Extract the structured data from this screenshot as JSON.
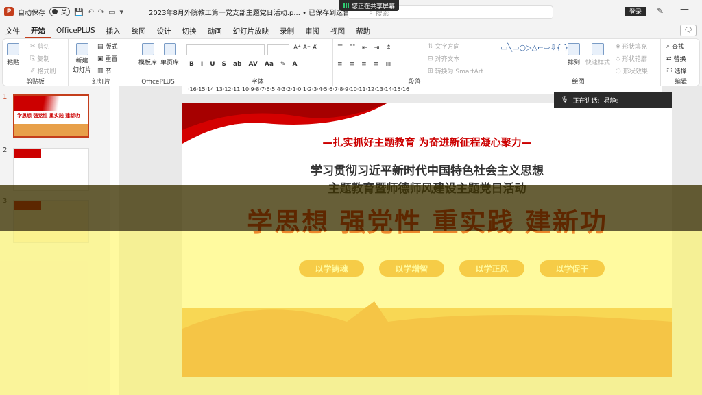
{
  "titlebar": {
    "autosave_label": "自动保存",
    "autosave_state": "关",
    "doc_title": "2023年8月外院教工第一党支部主题党日活动.p...",
    "save_status": "• 已保存到这台电脑",
    "share_banner": "您正在共享屏幕",
    "search_placeholder": "搜索",
    "login": "登录"
  },
  "menu": [
    "文件",
    "开始",
    "OfficePLUS",
    "插入",
    "绘图",
    "设计",
    "切换",
    "动画",
    "幻灯片放映",
    "录制",
    "审阅",
    "视图",
    "帮助"
  ],
  "ribbon": {
    "clipboard": {
      "paste": "粘贴",
      "cut": "剪切",
      "copy": "复制",
      "format_painter": "格式刷",
      "label": "剪贴板"
    },
    "slides": {
      "new_slide": "新建",
      "new_slide2": "幻灯片",
      "layout": "版式",
      "reset": "重置",
      "section": "节",
      "label": "幻灯片"
    },
    "officeplus": {
      "templates": "模板库",
      "single_page": "单页库",
      "label": "OfficePLUS"
    },
    "font": {
      "label": "字体"
    },
    "paragraph": {
      "text_direction": "文字方向",
      "align_text": "对齐文本",
      "smartart": "转换为 SmartArt",
      "label": "段落"
    },
    "drawing": {
      "arrange": "排列",
      "quick_styles": "快速样式",
      "shape_fill": "形状填充",
      "shape_outline": "形状轮廓",
      "shape_effects": "形状效果",
      "label": "绘图"
    },
    "editing": {
      "find": "查找",
      "replace": "替换",
      "select": "选择",
      "label": "编辑"
    }
  },
  "speaker": {
    "label": "正在讲话:",
    "name": "易静;"
  },
  "thumbnails": [
    {
      "num": "1",
      "title": "学思想 强党性 重实践 建新功"
    },
    {
      "num": "2",
      "title": ""
    },
    {
      "num": "3",
      "title": ""
    }
  ],
  "ruler_h": "·16·15·14·13·12·11·10·9·8·7·6·5·4·3·2·1·0·1·2·3·4·5·6·7·8·9·10·11·12·13·14·15·16",
  "slide": {
    "subtitle": "—扎实抓好主题教育 为奋进新征程凝心聚力—",
    "main_line1": "学习贯彻习近平新时代中国特色社会主义思想",
    "main_line2": "主题教育暨师德师风建设主题党日活动",
    "big_title": "学思想 强党性 重实践 建新功",
    "pills": [
      "以学铸魂",
      "以学增智",
      "以学正风",
      "以学促干"
    ]
  },
  "colors": {
    "accent": "#c43e1c",
    "slide_red": "#d40000",
    "pill": "#ea9a3c"
  }
}
